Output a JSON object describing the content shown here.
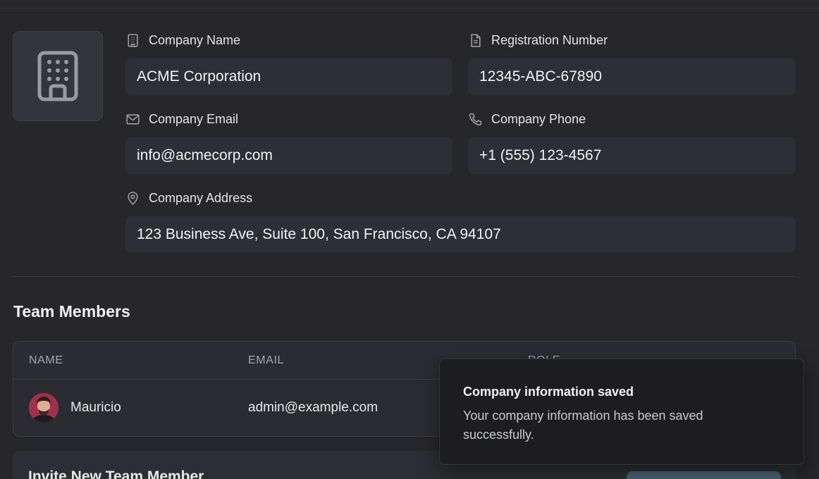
{
  "company": {
    "name_label": "Company Name",
    "name_value": "ACME Corporation",
    "registration_label": "Registration Number",
    "registration_value": "12345-ABC-67890",
    "email_label": "Company Email",
    "email_value": "info@acmecorp.com",
    "phone_label": "Company Phone",
    "phone_value": "+1 (555) 123-4567",
    "address_label": "Company Address",
    "address_value": "123 Business Ave, Suite 100, San Francisco, CA 94107"
  },
  "team": {
    "title": "Team Members",
    "columns": [
      "NAME",
      "EMAIL",
      "ROLE"
    ],
    "members": [
      {
        "name": "Mauricio",
        "email": "admin@example.com"
      }
    ]
  },
  "invite": {
    "title": "Invite New Team Member"
  },
  "toast": {
    "title": "Company information saved",
    "body": "Your company information has been saved successfully."
  },
  "icons": {
    "logo": "building-icon",
    "name": "building-icon",
    "registration": "document-icon",
    "email": "mail-icon",
    "phone": "phone-icon",
    "address": "map-pin-icon"
  },
  "colors": {
    "background": "#27272b",
    "input": "#2e2f34",
    "toast": "#1d1d21",
    "invite_button": "#476470"
  }
}
